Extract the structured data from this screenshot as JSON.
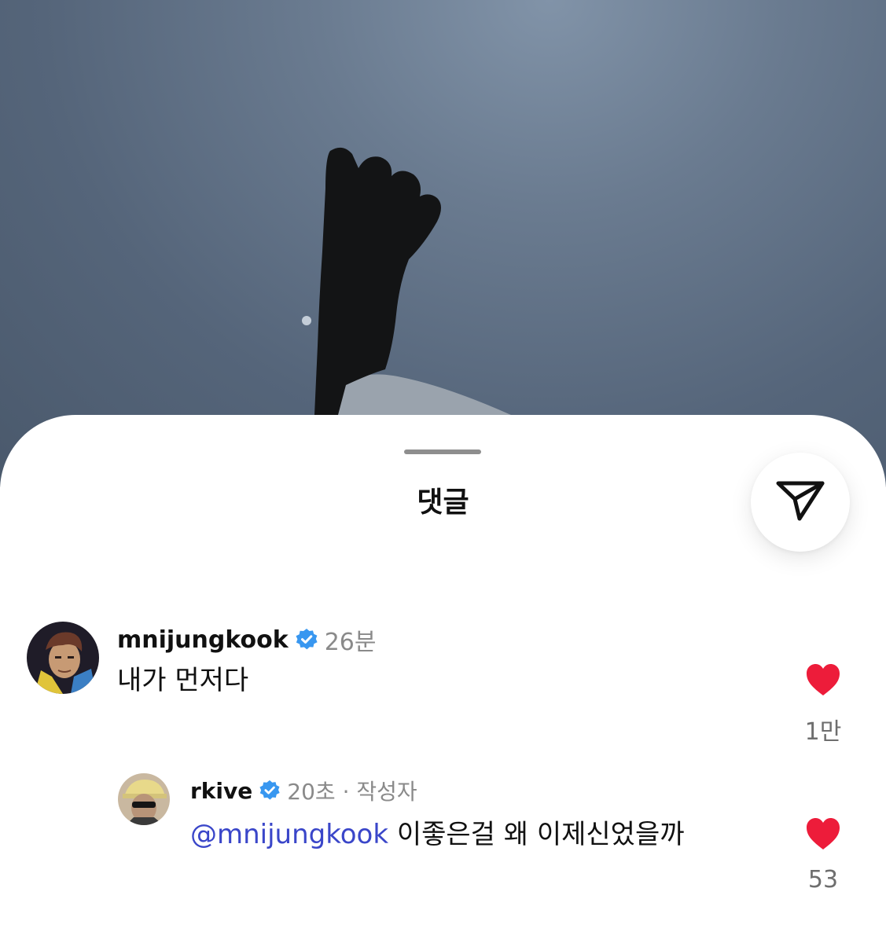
{
  "sheet": {
    "title": "댓글"
  },
  "colors": {
    "heart": "#ed1c3a",
    "mention": "#3a46c9",
    "verified": "#3897f0"
  },
  "icons": {
    "share": "paper-plane-icon",
    "verified": "verified-badge-icon",
    "like": "heart-filled-icon"
  },
  "comments": [
    {
      "username": "mnijungkook",
      "time": "26분",
      "text": "내가 먼저다",
      "likes": "1만"
    },
    {
      "username": "rkive",
      "time": "20초 · 작성자",
      "mention": "@mnijungkook",
      "text": "이좋은걸 왜 이제신었을까",
      "likes": "53"
    }
  ]
}
